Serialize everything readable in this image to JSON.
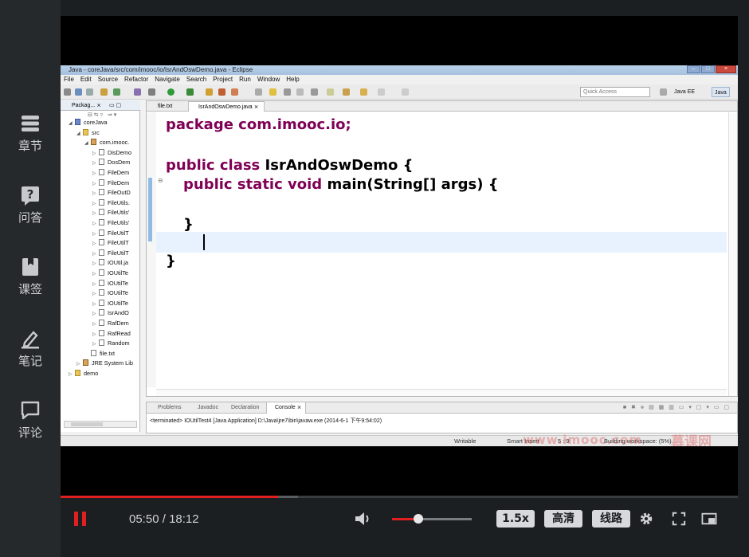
{
  "rail": {
    "items": [
      {
        "label": "章节",
        "icon": "chapters-icon"
      },
      {
        "label": "问答",
        "icon": "question-icon"
      },
      {
        "label": "课签",
        "icon": "bookmark-icon"
      },
      {
        "label": "笔记",
        "icon": "note-pen-icon"
      },
      {
        "label": "评论",
        "icon": "comment-icon"
      }
    ]
  },
  "eclipse": {
    "title": "Java - coreJava/src/com/imooc/io/IsrAndOswDemo.java - Eclipse",
    "menu": [
      "File",
      "Edit",
      "Source",
      "Refactor",
      "Navigate",
      "Search",
      "Project",
      "Run",
      "Window",
      "Help"
    ],
    "quick_access": "Quick Access",
    "perspectives": [
      "Java EE",
      "Java"
    ],
    "package_explorer_tab": "Packag...",
    "tree": [
      {
        "label": "coreJava",
        "level": 0,
        "icon": "project"
      },
      {
        "label": "src",
        "level": 1,
        "icon": "folder"
      },
      {
        "label": "com.imooc.",
        "level": 2,
        "icon": "package"
      },
      {
        "label": "DisDemo",
        "level": 3,
        "icon": "file"
      },
      {
        "label": "DosDem",
        "level": 3,
        "icon": "file"
      },
      {
        "label": "FileDem",
        "level": 3,
        "icon": "file"
      },
      {
        "label": "FileDem",
        "level": 3,
        "icon": "file"
      },
      {
        "label": "FileOutD",
        "level": 3,
        "icon": "file"
      },
      {
        "label": "FileUtils.",
        "level": 3,
        "icon": "file"
      },
      {
        "label": "FileUtils'",
        "level": 3,
        "icon": "file"
      },
      {
        "label": "FileUtils'",
        "level": 3,
        "icon": "file"
      },
      {
        "label": "FileUtilT",
        "level": 3,
        "icon": "file"
      },
      {
        "label": "FileUtilT",
        "level": 3,
        "icon": "file"
      },
      {
        "label": "FileUtilT",
        "level": 3,
        "icon": "file"
      },
      {
        "label": "IOUtil.ja",
        "level": 3,
        "icon": "file"
      },
      {
        "label": "IOUtilTe",
        "level": 3,
        "icon": "file"
      },
      {
        "label": "IOUtilTe",
        "level": 3,
        "icon": "file"
      },
      {
        "label": "IOUtilTe",
        "level": 3,
        "icon": "file"
      },
      {
        "label": "IOUtilTe",
        "level": 3,
        "icon": "file"
      },
      {
        "label": "IsrAndO",
        "level": 3,
        "icon": "file"
      },
      {
        "label": "RafDem",
        "level": 3,
        "icon": "file"
      },
      {
        "label": "RafRead",
        "level": 3,
        "icon": "file"
      },
      {
        "label": "Random",
        "level": 3,
        "icon": "file"
      },
      {
        "label": "file.txt",
        "level": 2,
        "icon": "file"
      },
      {
        "label": "JRE System Lib",
        "level": 1,
        "icon": "library"
      },
      {
        "label": "demo",
        "level": 0,
        "icon": "folder"
      }
    ],
    "editor_tabs": [
      "file.txt",
      "IsrAndOswDemo.java"
    ],
    "code": {
      "line1": "package com.imooc.io;",
      "line3_kw": "public class",
      "line3_rest": " IsrAndOswDemo {",
      "line4_kw": "public static void",
      "line4_rest": " main(String[] args) {",
      "line6": "}",
      "line8": "}"
    },
    "bottom_tabs": [
      "Problems",
      "Javadoc",
      "Declaration",
      "Console"
    ],
    "console_text": "<terminated> IOUtilTest4 [Java Application] D:\\Java\\jre7\\bin\\javaw.exe (2014-6-1 下午9:54:02)",
    "status": [
      "Writable",
      "Smart Insert",
      "5 : 9",
      "Building workspace: (5%)"
    ],
    "watermark": "www.imooc.com",
    "watermark_logo": "慕课网"
  },
  "player": {
    "time_current": "05:50",
    "time_separator": " / ",
    "time_total": "18:12",
    "progress_fraction": 0.321,
    "volume_fraction": 0.33,
    "speed_label": "1.5x",
    "quality_label": "高清",
    "route_label": "线路",
    "accent": "#e02020"
  }
}
